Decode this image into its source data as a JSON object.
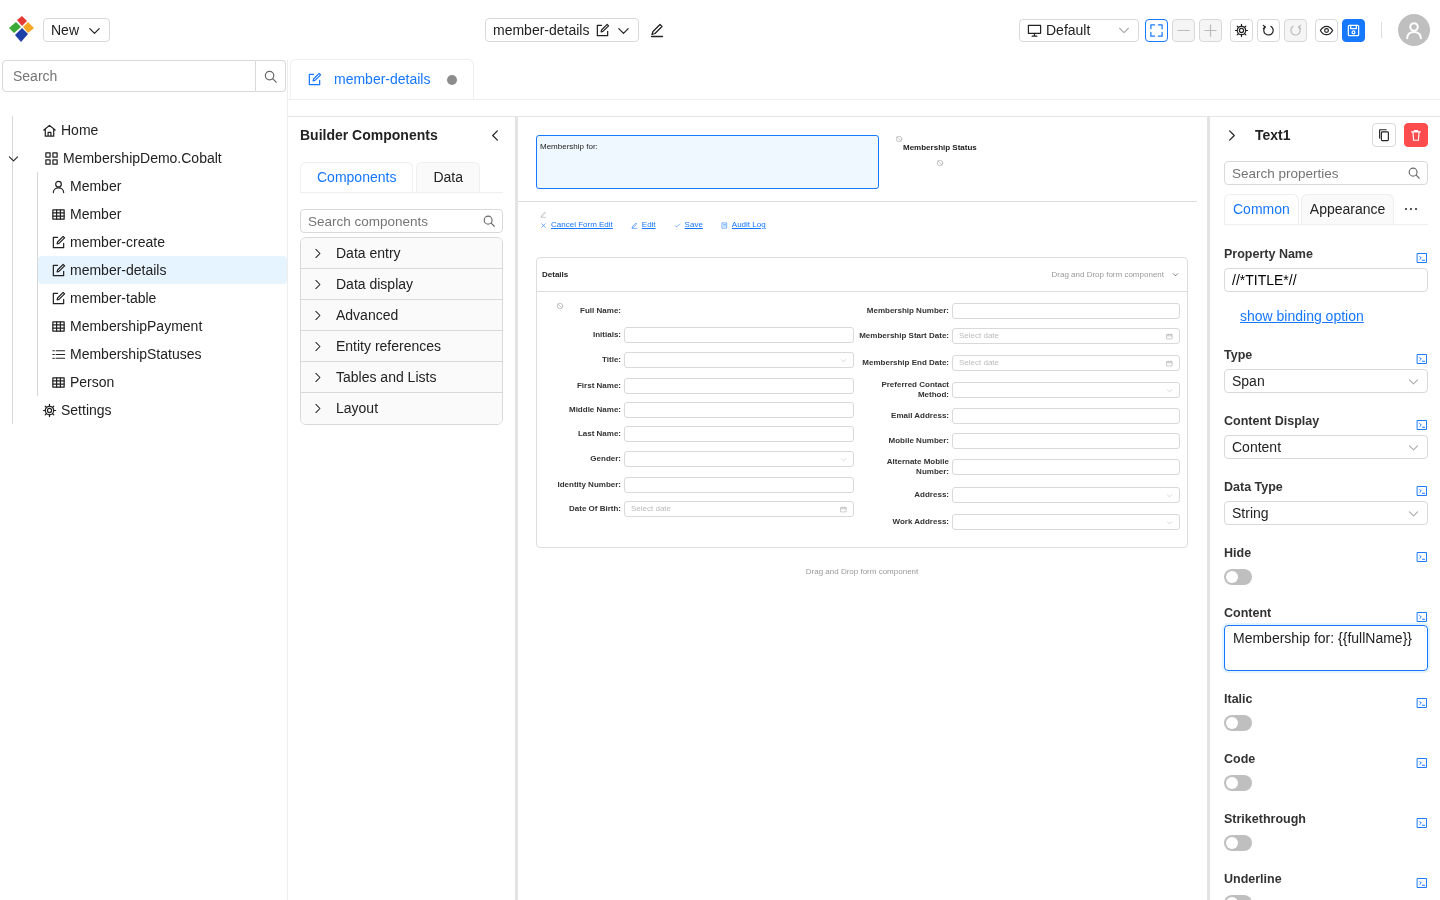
{
  "header": {
    "new_button": "New",
    "document": "member-details",
    "view": "Default",
    "toolbar": [
      {
        "kind": "fullscreen",
        "active": true,
        "disabled": false
      },
      {
        "kind": "zoom-out",
        "active": false,
        "disabled": true
      },
      {
        "kind": "zoom-in",
        "active": false,
        "disabled": true
      },
      {
        "kind": "settings",
        "active": false,
        "disabled": false
      },
      {
        "kind": "undo",
        "active": false,
        "disabled": false
      },
      {
        "kind": "redo",
        "active": false,
        "disabled": true
      },
      {
        "kind": "preview",
        "active": false,
        "disabled": false
      },
      {
        "kind": "save",
        "active": false,
        "disabled": false
      }
    ]
  },
  "sidebar": {
    "search": {
      "placeholder": "Search"
    },
    "tree": [
      {
        "label": "Home",
        "kind": "home",
        "selected": false
      },
      {
        "label": "MembershipDemo.Cobalt",
        "kind": "module",
        "selected": false,
        "expanded": true,
        "children": [
          {
            "label": "Member",
            "kind": "entity",
            "selected": false
          },
          {
            "label": "Member",
            "kind": "table",
            "selected": false
          },
          {
            "label": "member-create",
            "kind": "form",
            "selected": false
          },
          {
            "label": "member-details",
            "kind": "form",
            "selected": true
          },
          {
            "label": "member-table",
            "kind": "form",
            "selected": false
          },
          {
            "label": "MembershipPayment",
            "kind": "table",
            "selected": false
          },
          {
            "label": "MembershipStatuses",
            "kind": "list",
            "selected": false
          },
          {
            "label": "Person",
            "kind": "table",
            "selected": false
          }
        ]
      },
      {
        "label": "Settings",
        "kind": "settings",
        "selected": false
      }
    ]
  },
  "tabs": [
    {
      "label": "member-details",
      "selected": true,
      "modified": true
    }
  ],
  "builder": {
    "title": "Builder Components",
    "tabs": [
      {
        "label": "Components",
        "selected": true
      },
      {
        "label": "Data",
        "selected": false
      }
    ],
    "search": {
      "placeholder": "Search components"
    },
    "groups": [
      {
        "label": "Data entry",
        "expanded": false
      },
      {
        "label": "Data display",
        "expanded": false
      },
      {
        "label": "Advanced",
        "expanded": false
      },
      {
        "label": "Entity references",
        "expanded": false
      },
      {
        "label": "Tables and Lists",
        "expanded": false
      },
      {
        "label": "Layout",
        "expanded": false
      }
    ]
  },
  "canvas": {
    "text_component": {
      "text": "Membership for:",
      "selected": true
    },
    "status_label": "Membership Status",
    "actions": [
      {
        "kind": "cancel",
        "label": "Cancel Form Edit"
      },
      {
        "kind": "edit",
        "label": "Edit"
      },
      {
        "kind": "save",
        "label": "Save"
      },
      {
        "kind": "audit",
        "label": "Audit Log"
      }
    ],
    "panel": {
      "title": "Details",
      "hint": "Drag and Drop form component",
      "left_fields": [
        {
          "label": "Full Name:",
          "kind": "display"
        },
        {
          "label": "Initials:",
          "kind": "text"
        },
        {
          "label": "Title:",
          "kind": "select"
        },
        {
          "label": "First Name:",
          "kind": "text"
        },
        {
          "label": "Middle Name:",
          "kind": "text"
        },
        {
          "label": "Last Name:",
          "kind": "text"
        },
        {
          "label": "Gender:",
          "kind": "select"
        },
        {
          "label": "Identity Number:",
          "kind": "text"
        },
        {
          "label": "Date Of Birth:",
          "kind": "date",
          "placeholder": "Select date"
        }
      ],
      "right_fields": [
        {
          "label": "Membership Number:",
          "kind": "text"
        },
        {
          "label": "Membership Start Date:",
          "kind": "date",
          "placeholder": "Select date"
        },
        {
          "label": "Membership End Date:",
          "kind": "date",
          "placeholder": "Select date"
        },
        {
          "label": "Preferred Contact Method:",
          "kind": "select"
        },
        {
          "label": "Email Address:",
          "kind": "text"
        },
        {
          "label": "Mobile Number:",
          "kind": "text"
        },
        {
          "label": "Alternate Mobile Number:",
          "kind": "text"
        },
        {
          "label": "Address:",
          "kind": "select"
        },
        {
          "label": "Work Address:",
          "kind": "select"
        }
      ]
    },
    "footer_hint": "Drag and Drop form component"
  },
  "properties": {
    "title": "Text1",
    "search": {
      "placeholder": "Search properties"
    },
    "tabs": [
      {
        "label": "Common",
        "selected": true
      },
      {
        "label": "Appearance",
        "selected": false
      }
    ],
    "fields": [
      {
        "kind": "text",
        "label": "Property Name",
        "value": "//*TITLE*//"
      },
      {
        "kind": "link",
        "label": "show binding option"
      },
      {
        "kind": "select",
        "label": "Type",
        "value": "Span"
      },
      {
        "kind": "select",
        "label": "Content Display",
        "value": "Content"
      },
      {
        "kind": "select",
        "label": "Data Type",
        "value": "String"
      },
      {
        "kind": "switch",
        "label": "Hide",
        "on": false
      },
      {
        "kind": "textarea",
        "label": "Content",
        "value": "Membership for: {{fullName}}"
      },
      {
        "kind": "switch",
        "label": "Italic",
        "on": false
      },
      {
        "kind": "switch",
        "label": "Code",
        "on": false
      },
      {
        "kind": "switch",
        "label": "Strikethrough",
        "on": false
      },
      {
        "kind": "switch",
        "label": "Underline",
        "on": false
      }
    ]
  }
}
